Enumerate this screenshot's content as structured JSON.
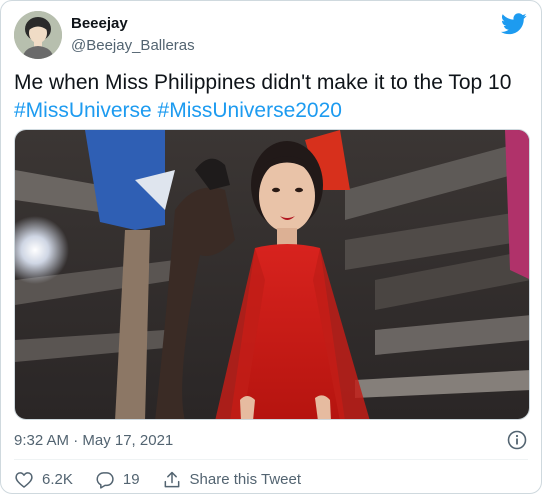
{
  "author": {
    "display_name": "Beeejay",
    "handle": "@Beejay_Balleras",
    "avatar_icon": "avatar-image"
  },
  "brand": {
    "icon": "twitter-bird-icon",
    "color": "#1d9bf0"
  },
  "tweet": {
    "text": "Me when Miss Philippines didn't make it to the Top 10",
    "hashtags": [
      "#MissUniverse",
      "#MissUniverse2020"
    ],
    "media_icon": "photo-woman-red-dress"
  },
  "meta": {
    "timestamp": "9:32 AM · May 17, 2021",
    "info_icon": "info-icon"
  },
  "actions": {
    "like": {
      "icon": "heart-icon",
      "label": "6.2K"
    },
    "reply": {
      "icon": "reply-bubble-icon",
      "label": "19"
    },
    "share": {
      "icon": "share-icon",
      "label": "Share this Tweet"
    }
  },
  "colors": {
    "text": "#0f1419",
    "secondary": "#536471",
    "accent": "#1d9bf0",
    "border": "#cfd9de"
  }
}
